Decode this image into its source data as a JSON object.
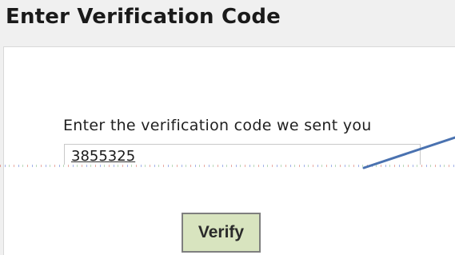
{
  "page": {
    "title": "Enter Verification Code"
  },
  "form": {
    "prompt": "Enter the verification code we sent you",
    "code_value": "3855325",
    "verify_label": "Verify"
  },
  "colors": {
    "panel_background": "#ffffff",
    "page_background": "#f0f0f0",
    "verify_button_background": "#d8e4bf",
    "verify_button_border": "#7f7f7f",
    "annotation_arrow": "#4a72b0"
  },
  "icons": {
    "annotation": "arrow-line-icon"
  }
}
